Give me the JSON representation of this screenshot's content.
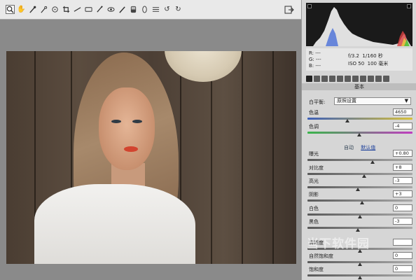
{
  "toolbar": {
    "tools": [
      "zoom-icon",
      "hand-icon",
      "white-balance-icon",
      "color-sampler-icon",
      "targeted-adjust-icon",
      "crop-icon",
      "straighten-icon",
      "spot-removal-icon",
      "red-eye-icon",
      "adjustment-brush-icon",
      "graduated-filter-icon",
      "radial-filter-icon",
      "preferences-icon",
      "rotate-ccw-icon",
      "rotate-cw-icon"
    ]
  },
  "info": {
    "r_label": "R:",
    "r_value": "---",
    "g_label": "G:",
    "g_value": "---",
    "b_label": "B:",
    "b_value": "---",
    "aperture": "f/3.2",
    "shutter": "1/160 秒",
    "iso": "ISO 50",
    "focal": "100 毫米"
  },
  "panel": {
    "section_title": "基本",
    "white_balance_label": "白平衡:",
    "white_balance_value": "原照设置",
    "auto_label": "自动",
    "default_label": "默认值"
  },
  "sliders": [
    {
      "label": "色温",
      "value": "4650",
      "position": 0.38
    },
    {
      "label": "色调",
      "value": "-4",
      "position": 0.49
    },
    {
      "label": "曝光",
      "value": "+0.80",
      "position": 0.62
    },
    {
      "label": "对比度",
      "value": "+8",
      "position": 0.54
    },
    {
      "label": "高光",
      "value": "-3",
      "position": 0.48
    },
    {
      "label": "阴影",
      "value": "+3",
      "position": 0.52
    },
    {
      "label": "白色",
      "value": "0",
      "position": 0.5
    },
    {
      "label": "黑色",
      "value": "-3",
      "position": 0.48
    },
    {
      "label": "清晰度",
      "value": "",
      "position": 0.5
    },
    {
      "label": "自然饱和度",
      "value": "0",
      "position": 0.5
    },
    {
      "label": "饱和度",
      "value": "0",
      "position": 0.5
    }
  ],
  "watermark": "当下软件园",
  "colors": {
    "temp_track_start": "#3c5fb8",
    "temp_track_end": "#d8c13a",
    "tint_track_start": "#39b54a",
    "tint_track_end": "#c03cc0"
  }
}
